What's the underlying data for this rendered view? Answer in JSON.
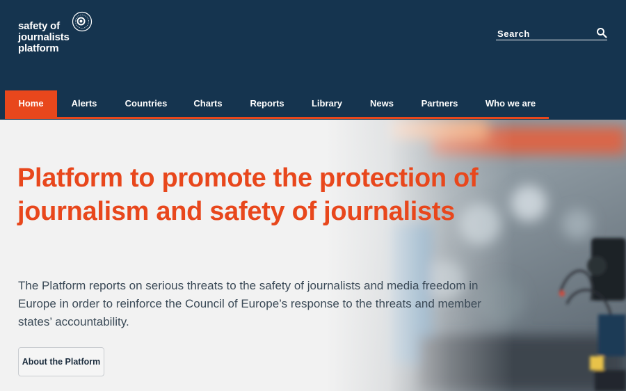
{
  "brand": {
    "logo_lines": [
      "safety of",
      "journalists",
      "platform"
    ],
    "colors": {
      "header_bg": "#15344f",
      "accent": "#e8471c",
      "page_bg": "#f2f2f2"
    }
  },
  "search": {
    "placeholder": "Search",
    "icon": "search-icon"
  },
  "nav": {
    "items": [
      {
        "label": "Home",
        "active": true
      },
      {
        "label": "Alerts"
      },
      {
        "label": "Countries"
      },
      {
        "label": "Charts"
      },
      {
        "label": "Reports"
      },
      {
        "label": "Library"
      },
      {
        "label": "News"
      },
      {
        "label": "Partners"
      },
      {
        "label": "Who we are"
      }
    ]
  },
  "hero": {
    "title": "Platform to promote the protection of journalism and safety of journalists",
    "description": "The Platform reports on serious threats to the safety of journalists and media freedom in Europe in order to reinforce the Council of Europe’s response to the threats and member states’ accountability.",
    "button_label": "About the Platform"
  }
}
